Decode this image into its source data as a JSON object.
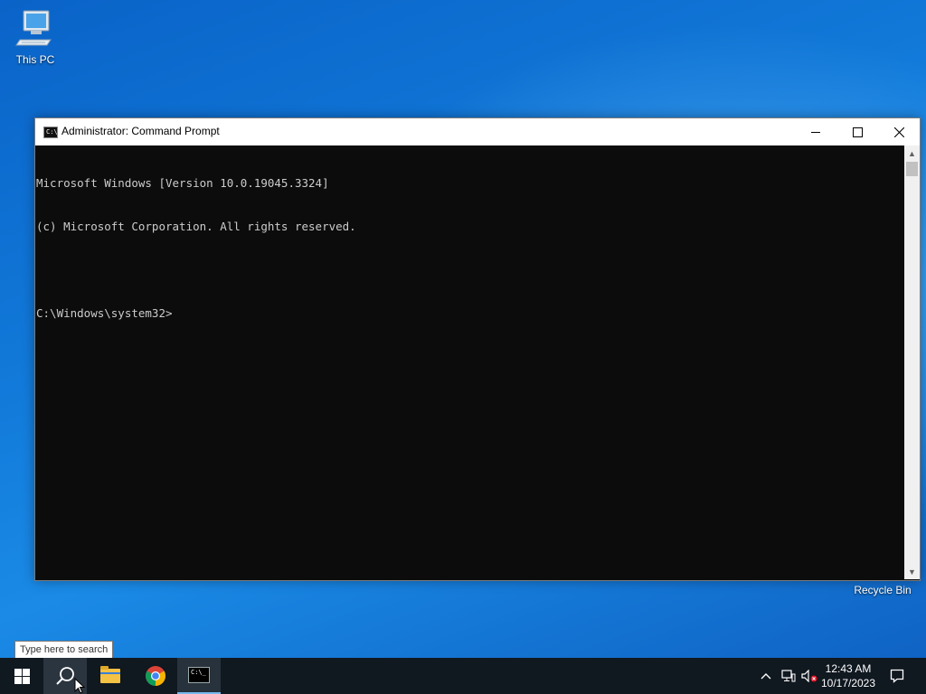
{
  "desktop": {
    "icons": [
      {
        "label": "This PC",
        "icon": "computer-icon"
      },
      {
        "label": "Recycle Bin",
        "icon": "recycle-bin-icon"
      }
    ]
  },
  "window": {
    "title": "Administrator: Command Prompt",
    "app_icon": "cmd-icon",
    "app_icon_text": "C:\\_",
    "controls": [
      "minimize",
      "maximize",
      "close"
    ],
    "console_lines": [
      "Microsoft Windows [Version 10.0.19045.3324]",
      "(c) Microsoft Corporation. All rights reserved.",
      "",
      "C:\\Windows\\system32>"
    ]
  },
  "search_tooltip": "Type here to search",
  "taskbar": {
    "buttons": [
      {
        "name": "start",
        "icon": "windows-logo-icon"
      },
      {
        "name": "search",
        "icon": "search-icon"
      },
      {
        "name": "file-explorer",
        "icon": "folder-icon"
      },
      {
        "name": "google-chrome",
        "icon": "chrome-icon"
      },
      {
        "name": "command-prompt",
        "icon": "cmd-icon",
        "active": true
      }
    ],
    "tray": {
      "icons": [
        "chevron-up-icon",
        "network-icon",
        "volume-muted-icon"
      ],
      "time": "12:43 AM",
      "date": "10/17/2023",
      "notifications_icon": "notification-icon"
    }
  },
  "colors": {
    "console_bg": "#0c0c0c",
    "console_fg": "#cccccc",
    "taskbar_bg": "#101820",
    "active_underline": "#76b9ed"
  }
}
